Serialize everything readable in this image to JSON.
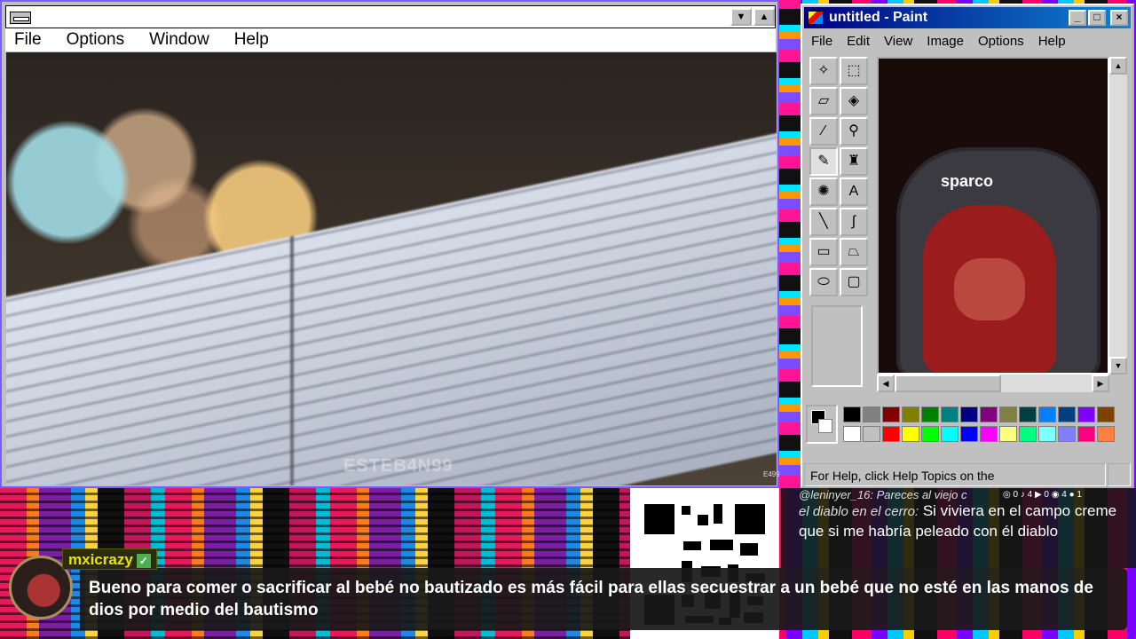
{
  "main_window": {
    "menu": [
      "File",
      "Options",
      "Window",
      "Help"
    ],
    "min_glyph": "▼",
    "max_glyph": "▲",
    "watermark": "ESTEB4N99",
    "corner_mark": "E499"
  },
  "paint": {
    "title": "untitled - Paint",
    "menu": [
      "File",
      "Edit",
      "View",
      "Image",
      "Options",
      "Help"
    ],
    "status": "For Help, click Help Topics on the",
    "chair_brand": "sparco",
    "palette_top": [
      "#000000",
      "#808080",
      "#800000",
      "#808000",
      "#008000",
      "#008080",
      "#000080",
      "#800080",
      "#808040",
      "#004040",
      "#0080ff",
      "#004080",
      "#8000ff",
      "#804000"
    ],
    "palette_bottom": [
      "#ffffff",
      "#c0c0c0",
      "#ff0000",
      "#ffff00",
      "#00ff00",
      "#00ffff",
      "#0000ff",
      "#ff00ff",
      "#ffff80",
      "#00ff80",
      "#80ffff",
      "#8080ff",
      "#ff0080",
      "#ff8040"
    ]
  },
  "chat_side": {
    "line1": "@leninyer_16: Pareces al viejo c",
    "who": "el diablo en el cerro:",
    "text": "Si viviera en el campo creme que si me habría peleado con él diablo",
    "socials": "◎ 0  ♪ 4  ▶ 0  ◉ 4  ● 1"
  },
  "chat_main": {
    "username": "mxicrazy",
    "message": "Bueno para comer o sacrificar al bebé no bautizado es más fácil para ellas secuestrar a un bebé que no esté en las manos de dios por medio del bautismo"
  }
}
